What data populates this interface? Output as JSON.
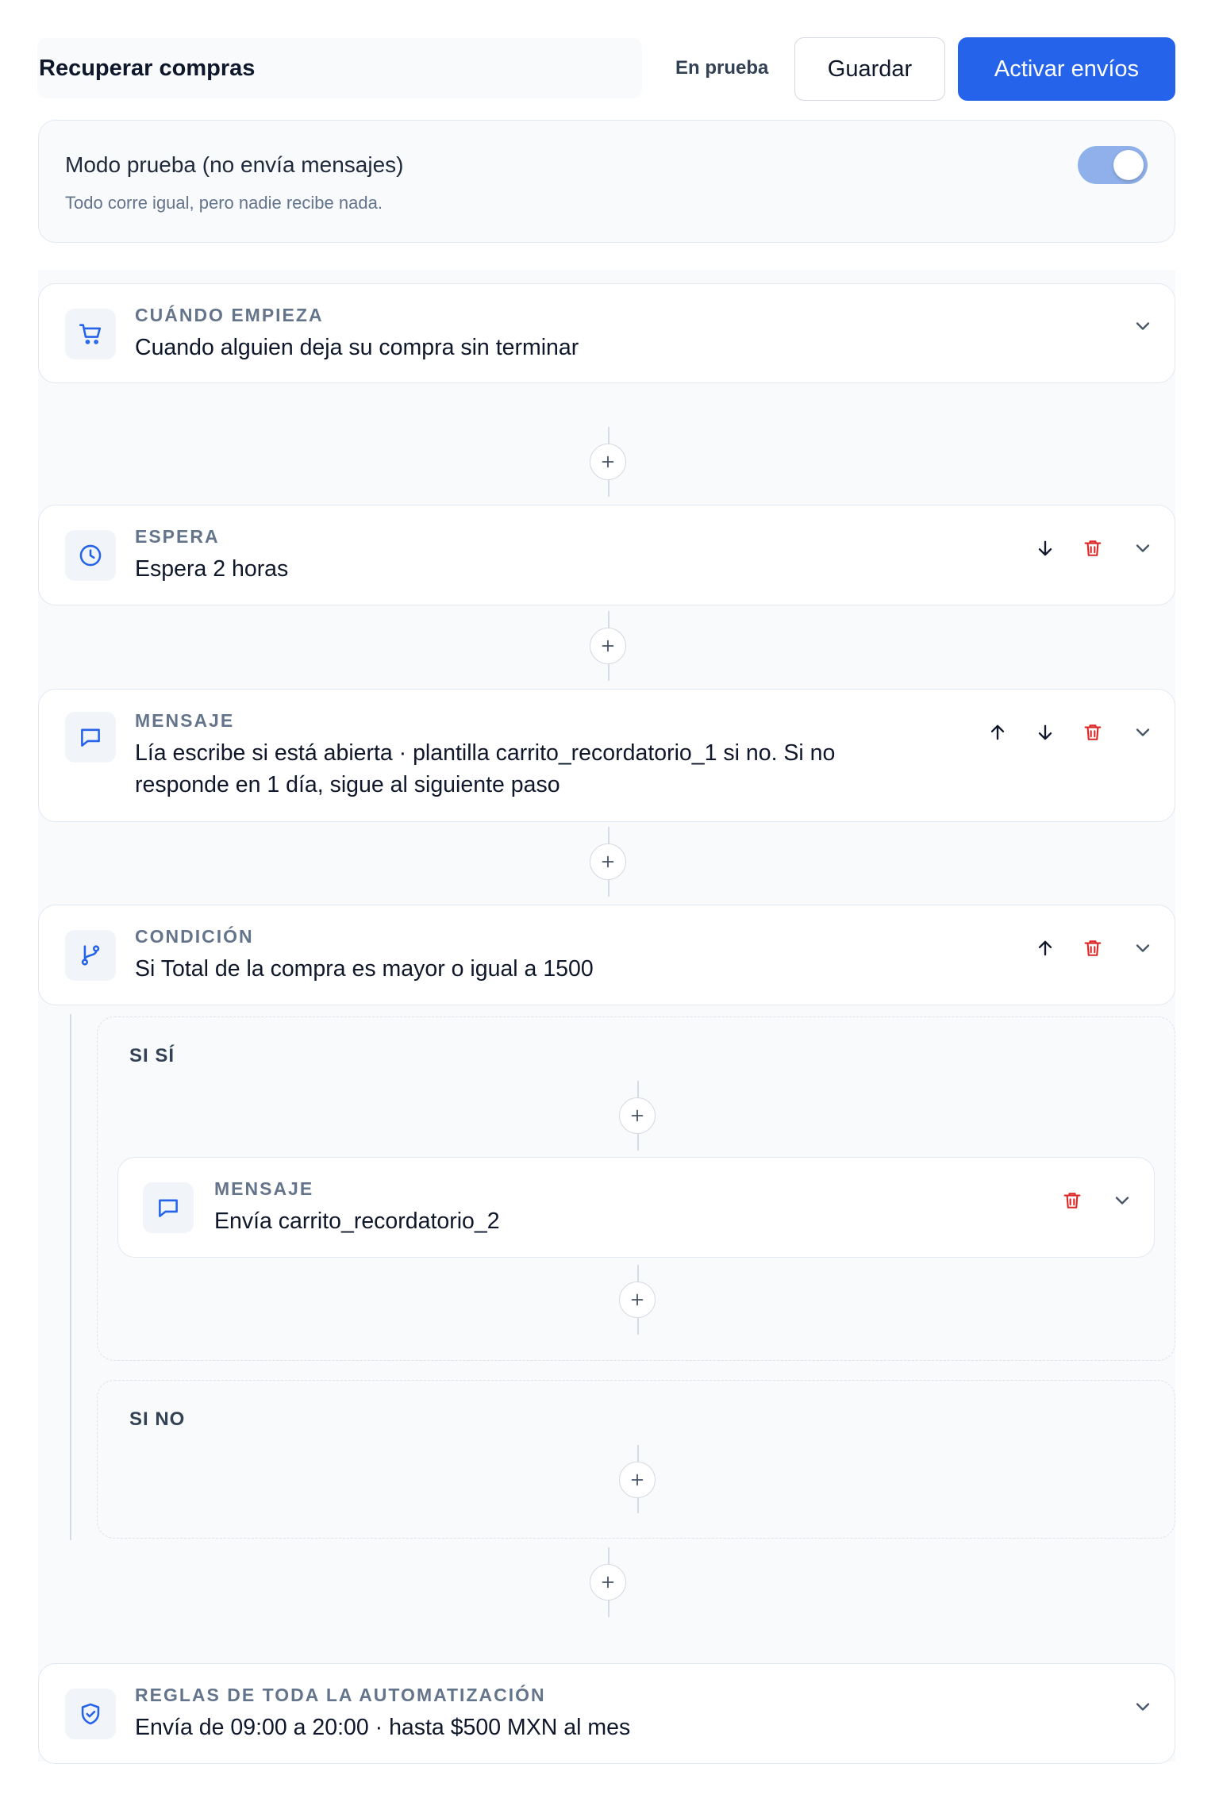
{
  "header": {
    "title": "Recuperar compras",
    "status": "En prueba",
    "save_label": "Guardar",
    "activate_label": "Activar envíos"
  },
  "test_mode": {
    "title": "Modo prueba (no envía mensajes)",
    "subtitle": "Todo corre igual, pero nadie recibe nada.",
    "enabled": true
  },
  "steps": [
    {
      "label": "CUÁNDO EMPIEZA",
      "description": "Cuando alguien deja su compra sin terminar",
      "icon": "cart-icon"
    },
    {
      "label": "ESPERA",
      "description": "Espera 2 horas",
      "icon": "clock-icon"
    },
    {
      "label": "MENSAJE",
      "description_line1": "Lía escribe si está abierta · plantilla carrito_recordatorio_1 si no. Si no",
      "description_line2": "responde en 1 día, sigue al siguiente paso",
      "icon": "message-icon"
    },
    {
      "label": "CONDICIÓN",
      "description": "Si Total de la compra es mayor o igual a 1500",
      "icon": "branch-icon"
    }
  ],
  "branches": {
    "yes": {
      "label": "SI SÍ",
      "step": {
        "label": "MENSAJE",
        "description": "Envía carrito_recordatorio_2",
        "icon": "message-icon"
      }
    },
    "no": {
      "label": "SI NO"
    }
  },
  "rules": {
    "label": "REGLAS DE TODA LA AUTOMATIZACIÓN",
    "description": "Envía de 09:00 a 20:00 · hasta $500 MXN al mes",
    "icon": "shield-check-icon"
  },
  "colors": {
    "accent": "#2563eb",
    "delete": "#dc2626",
    "toggle_on": "#8fb0ea"
  }
}
